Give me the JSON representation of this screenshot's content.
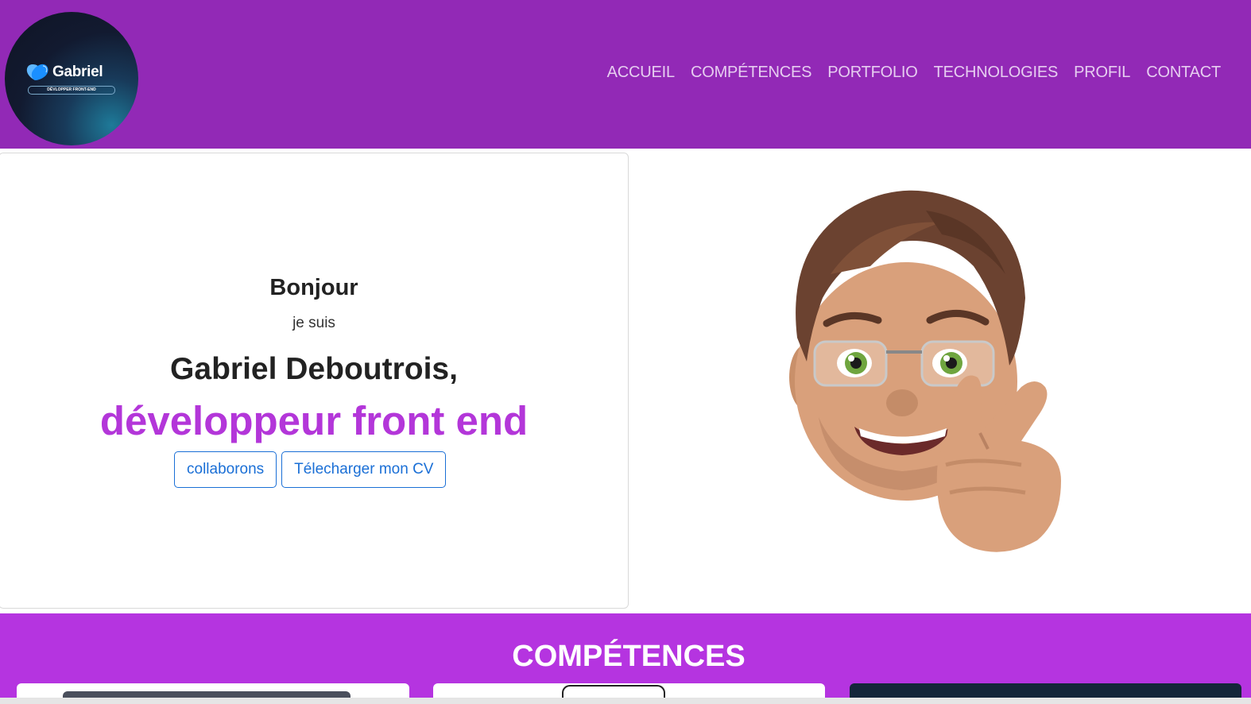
{
  "logo": {
    "name": "Gabriel",
    "tagline": "DÉVLOPPER FRONT-END"
  },
  "nav": {
    "items": [
      {
        "label": "ACCUEIL"
      },
      {
        "label": "COMPÉTENCES"
      },
      {
        "label": "PORTFOLIO"
      },
      {
        "label": "TECHNOLOGIES"
      },
      {
        "label": "PROFIL"
      },
      {
        "label": "CONTACT"
      }
    ]
  },
  "hero": {
    "greeting": "Bonjour",
    "intro": "je suis",
    "name": "Gabriel Deboutrois,",
    "role": "développeur front end",
    "buttons": [
      {
        "label": "collaborons"
      },
      {
        "label": "Télecharger mon CV"
      }
    ]
  },
  "skills": {
    "title": "COMPÉTENCES"
  },
  "colors": {
    "navbar": "#9229b6",
    "accent": "#b336d9",
    "skills_bg": "#b534e0",
    "button_text": "#1a6fd6"
  }
}
